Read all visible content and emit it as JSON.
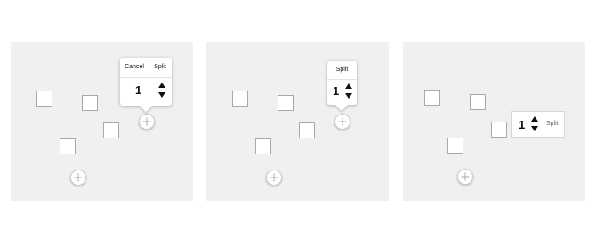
{
  "panel1": {
    "popover": {
      "cancel_label": "Cancel",
      "split_label": "Split",
      "value": "1"
    }
  },
  "panel2": {
    "popover": {
      "split_label": "Split",
      "value": "1"
    }
  },
  "panel3": {
    "inline_control": {
      "value": "1",
      "split_label": "Split"
    }
  },
  "icons": {
    "handle": "plus-crosshair-icon",
    "stepper": "up-down-triangles-icon"
  },
  "colors": {
    "panel_bg": "#f0f0f0",
    "square_border": "#a8a8a8",
    "text": "#111111"
  }
}
